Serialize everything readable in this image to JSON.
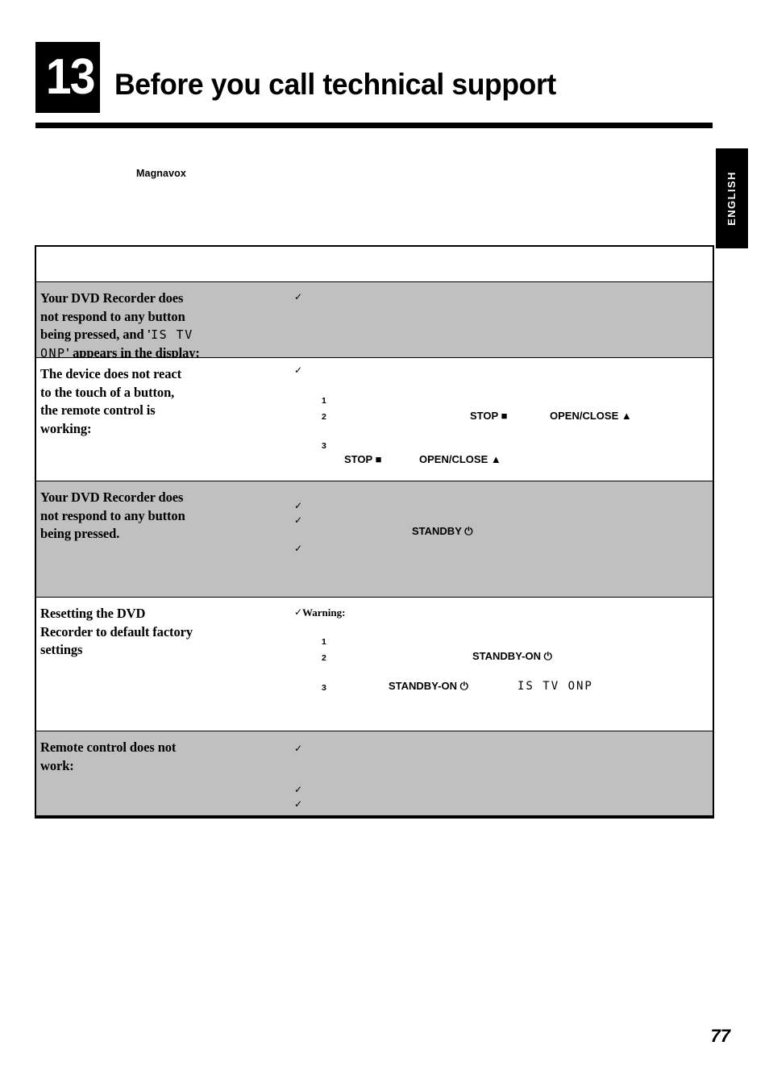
{
  "chapter": {
    "number": "13",
    "title": "Before you call technical support"
  },
  "side_tab": {
    "label": "ENGLISH"
  },
  "brand": {
    "name": "Magnavox"
  },
  "page": {
    "number": "77"
  },
  "icons": {
    "check": "✓",
    "stop_square": "■",
    "eject_triangle": "▲",
    "power": "⏻"
  },
  "colors": {
    "shade": "#c0c0c0",
    "rule": "#000000",
    "paper": "#ffffff"
  },
  "table": {
    "header": {
      "symptom_label": "",
      "fix_label": ""
    },
    "rows": [
      {
        "shaded": true,
        "symptom_lines": [
          "Your DVD Recorder does",
          "not respond to any button",
          "being pressed, and '",
          "' appears in the display:"
        ],
        "symptom_lcd_1": "IS TV",
        "symptom_lcd_2": "ONP",
        "ticks": 1,
        "steps": [],
        "buttons": []
      },
      {
        "shaded": false,
        "symptom_lines": [
          "The device does not react",
          "to the touch of a button,",
          "the remote control is",
          "working:"
        ],
        "ticks": 1,
        "steps": [
          "1",
          "2",
          "3"
        ],
        "buttons": [
          {
            "label": "STOP",
            "glyph": "■"
          },
          {
            "label": "OPEN/CLOSE",
            "glyph": "▲"
          },
          {
            "label": "STOP",
            "glyph": "■"
          },
          {
            "label": "OPEN/CLOSE",
            "glyph": "▲"
          }
        ]
      },
      {
        "shaded": true,
        "symptom_lines": [
          "Your DVD Recorder does",
          "not respond to any button",
          "being pressed."
        ],
        "ticks": 3,
        "steps": [],
        "buttons": [
          {
            "label": "STANDBY",
            "glyph": "⏻"
          }
        ]
      },
      {
        "shaded": false,
        "symptom_lines": [
          "Resetting the DVD",
          "Recorder to default factory",
          "settings"
        ],
        "ticks": 1,
        "warning_label": "Warning:",
        "steps": [
          "1",
          "2",
          "3"
        ],
        "buttons": [
          {
            "label": "STANDBY-ON",
            "glyph": "⏻"
          },
          {
            "label": "STANDBY-ON",
            "glyph": "⏻"
          }
        ],
        "lcd_display": "IS TV ONP"
      },
      {
        "shaded": true,
        "symptom_lines": [
          "Remote control does not",
          "work:"
        ],
        "ticks": 3,
        "steps": [],
        "buttons": []
      }
    ]
  }
}
